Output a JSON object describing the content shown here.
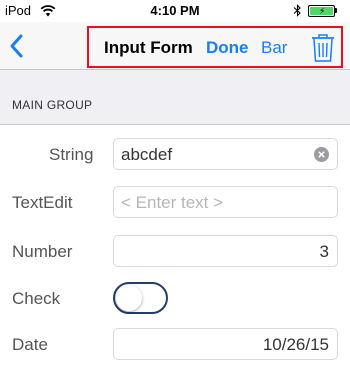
{
  "status_bar": {
    "carrier": "iPod",
    "time": "4:10 PM",
    "icons": [
      "wifi-icon",
      "bluetooth-icon",
      "battery-charging-icon"
    ]
  },
  "nav_bar": {
    "back_icon": "chevron-left-icon",
    "title": "Input Form",
    "done_label": "Done",
    "bar_label": "Bar",
    "trash_icon": "trash-icon",
    "highlight_color": "#e8101e",
    "tint_color": "#147efb"
  },
  "section": {
    "header": "MAIN GROUP"
  },
  "form": {
    "string": {
      "label": "String",
      "value": "abcdef"
    },
    "textedit": {
      "label": "TextEdit",
      "placeholder": "< Enter text >"
    },
    "number": {
      "label": "Number",
      "value": "3"
    },
    "check": {
      "label": "Check",
      "checked": false
    },
    "date": {
      "label": "Date",
      "value": "10/26/15"
    }
  }
}
